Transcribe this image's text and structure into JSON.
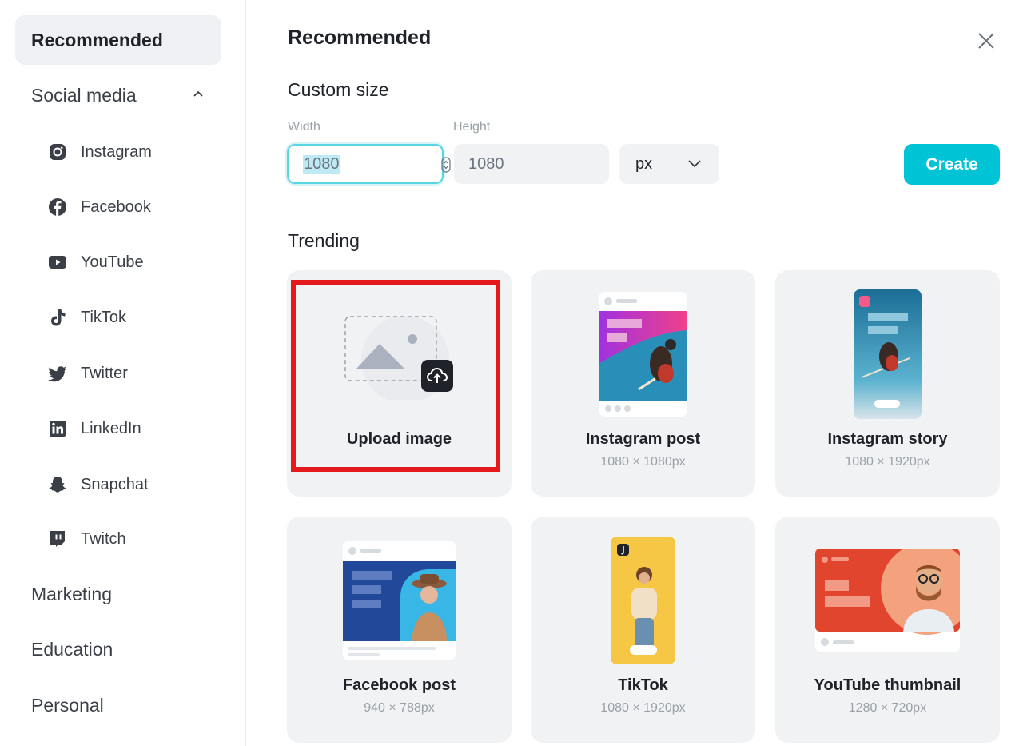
{
  "sidebar": {
    "categories": [
      {
        "label": "Recommended"
      },
      {
        "label": "Social media"
      },
      {
        "label": "Marketing"
      },
      {
        "label": "Education"
      },
      {
        "label": "Personal"
      }
    ],
    "social_items": [
      {
        "label": "Instagram",
        "icon": "instagram-icon"
      },
      {
        "label": "Facebook",
        "icon": "facebook-icon"
      },
      {
        "label": "YouTube",
        "icon": "youtube-icon"
      },
      {
        "label": "TikTok",
        "icon": "tiktok-icon"
      },
      {
        "label": "Twitter",
        "icon": "twitter-icon"
      },
      {
        "label": "LinkedIn",
        "icon": "linkedin-icon"
      },
      {
        "label": "Snapchat",
        "icon": "snapchat-icon"
      },
      {
        "label": "Twitch",
        "icon": "twitch-icon"
      }
    ]
  },
  "main": {
    "title": "Recommended",
    "custom_size": {
      "heading": "Custom size",
      "width_label": "Width",
      "width_value": "1080",
      "height_label": "Height",
      "height_value": "1080",
      "unit": "px",
      "create_label": "Create"
    },
    "trending": {
      "heading": "Trending",
      "cards": [
        {
          "name": "Upload image",
          "size": ""
        },
        {
          "name": "Instagram post",
          "size": "1080 × 1080px"
        },
        {
          "name": "Instagram story",
          "size": "1080 × 1920px"
        },
        {
          "name": "Facebook post",
          "size": "940 × 788px"
        },
        {
          "name": "TikTok",
          "size": "1080 × 1920px"
        },
        {
          "name": "YouTube thumbnail",
          "size": "1280 × 720px"
        }
      ]
    }
  },
  "colors": {
    "accent": "#00c4d6",
    "highlight_border": "#e3191c",
    "card_bg": "#f1f2f4",
    "active_bg": "#eef0f3"
  }
}
